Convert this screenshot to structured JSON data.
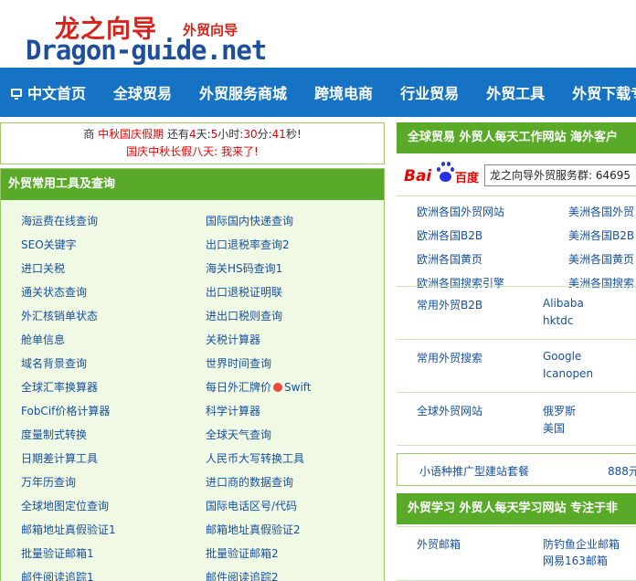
{
  "logo": {
    "cn": "龙之向导",
    "sub": "外贸向导",
    "en": "Dragon-guide.net"
  },
  "nav": {
    "items": [
      "中文首页",
      "全球贸易",
      "外贸服务商城",
      "跨境电商",
      "行业贸易",
      "外贸工具",
      "外贸下载专"
    ]
  },
  "notice": {
    "shang": "商",
    "holiday": "中秋国庆假期",
    "still": "还有",
    "days": "4",
    "day_unit": "天:",
    "hours": "5",
    "hour_unit": "小时:",
    "minutes": "30",
    "min_unit": "分:",
    "seconds": "41",
    "sec_unit": "秒!",
    "line2": "国庆中秋长假八天: 我来了!"
  },
  "tools": {
    "title": "外贸常用工具及查询",
    "left_col": [
      "海运费在线查询",
      "SEO关键字",
      "进口关税",
      "通关状态查询",
      "外汇核销单状态",
      "舱单信息",
      "域名背景查询",
      "全球汇率换算器",
      "FobCif价格计算器",
      "度量制式转换",
      "日期差计算工具",
      "万年历查询",
      "全球地图定位查询",
      "邮箱地址真假验证1",
      "批量验证邮箱1",
      "邮件阅读追踪1"
    ],
    "right_col": [
      "国际国内快递查询",
      "出口退税率查询2",
      "海关HS码查询1",
      "出口退税证明联",
      "进出口税则查询",
      "关税计算器",
      "世界时间查询",
      "每日外汇牌价",
      "科学计算器",
      "全球天气查询",
      "人民币大写转换工具",
      "进口商的数据查询",
      "国际电话区号/代码",
      "邮箱地址真假验证2",
      "批量验证邮箱2",
      "邮件阅读追踪2"
    ],
    "swift": "Swift"
  },
  "right": {
    "head1": "全球贸易  外贸人每天工作网站 海外客户",
    "baidu": {
      "bai": "Bai",
      "du": "百度"
    },
    "search_value": "龙之向导外贸服务群: 64695",
    "links_a": [
      "欧洲各国外贸网站",
      "欧洲各国B2B",
      "欧洲各国黄页",
      "欧洲各国搜索引擎"
    ],
    "links_b": [
      "美洲各国外贸",
      "美洲各国B2B",
      "美洲各国黄页",
      "美洲各国搜索"
    ],
    "sections": [
      {
        "label": "常用外贸B2B",
        "links": [
          "Alibaba",
          "hktdc"
        ]
      },
      {
        "label": "常用外贸搜索",
        "links": [
          "Google",
          "Icanopen"
        ]
      },
      {
        "label": "全球外贸网站",
        "links": [
          "俄罗斯",
          "美国"
        ]
      }
    ],
    "promo": {
      "text": "小语种推广型建站套餐",
      "price": "888元"
    },
    "head2": "外贸学习  外贸人每天学习网站 专注于非",
    "mail": {
      "label": "外贸邮箱",
      "links": [
        "防钓鱼企业邮箱",
        "网易163邮箱"
      ]
    }
  },
  "colors": {
    "nav_blue": "#1672c2",
    "green": "#5aaa2a",
    "link": "#1650a0",
    "red": "#e60000"
  }
}
